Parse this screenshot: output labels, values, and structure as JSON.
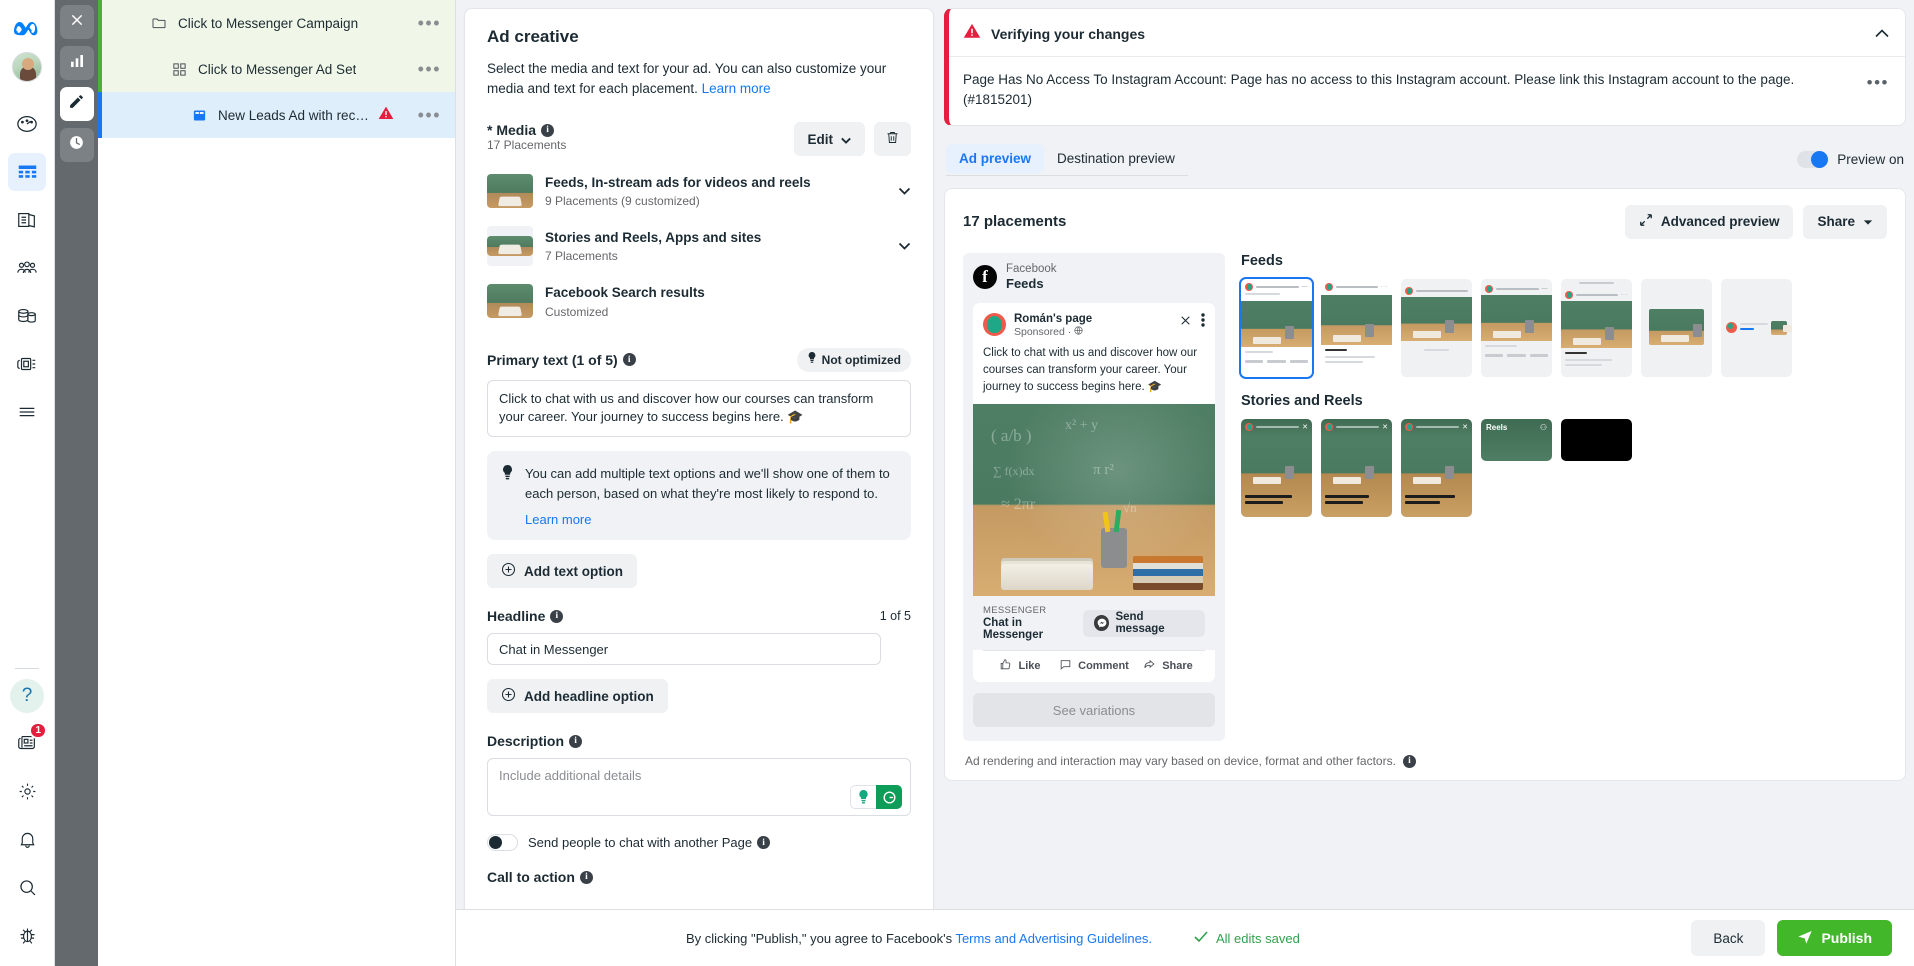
{
  "nav": {
    "logo": "meta-logo",
    "items": [
      {
        "name": "speedometer-icon",
        "label": "Performance"
      },
      {
        "name": "table-icon",
        "label": "Campaigns"
      },
      {
        "name": "pages-icon",
        "label": "Pages"
      },
      {
        "name": "audience-icon",
        "label": "Audiences"
      },
      {
        "name": "billing-icon",
        "label": "Billing"
      },
      {
        "name": "assets-icon",
        "label": "Assets"
      },
      {
        "name": "menu-icon",
        "label": "All tools"
      }
    ],
    "help_label": "?",
    "notifications_badge": "1",
    "bottom_items": [
      {
        "name": "news-icon",
        "label": "News"
      },
      {
        "name": "gear-icon",
        "label": "Settings"
      },
      {
        "name": "bell-icon",
        "label": "Notifications"
      },
      {
        "name": "search-icon",
        "label": "Search"
      },
      {
        "name": "bug-icon",
        "label": "Report a bug"
      }
    ]
  },
  "toolstrip": {
    "items": [
      {
        "name": "close-icon",
        "label": "Close"
      },
      {
        "name": "chart-icon",
        "label": "Charts"
      },
      {
        "name": "edit-icon",
        "label": "Edit"
      },
      {
        "name": "history-icon",
        "label": "History"
      }
    ]
  },
  "tree": {
    "rows": [
      {
        "label": "Click to Messenger Campaign",
        "icon": "folder-icon",
        "more": "•••"
      },
      {
        "label": "Click to Messenger Ad Set",
        "icon": "grid-icon",
        "more": "•••"
      },
      {
        "label": "New Leads Ad with recomme…",
        "icon": "ad-icon",
        "more": "•••",
        "warning": true
      }
    ]
  },
  "creative": {
    "title": "Ad creative",
    "description": "Select the media and text for your ad. You can also customize your media and text for each placement.",
    "learn_more": "Learn more",
    "media_label": "* Media",
    "media_sub": "17 Placements",
    "edit_button": "Edit",
    "delete_icon": "trash-icon",
    "media_items": [
      {
        "name": "Feeds, In-stream ads for videos and reels",
        "sub": "9 Placements (9 customized)"
      },
      {
        "name": "Stories and Reels, Apps and sites",
        "sub": "7 Placements"
      },
      {
        "name": "Facebook Search results",
        "sub": "Customized"
      }
    ],
    "primary_text_label": "Primary text (1 of 5)",
    "not_optimized_badge": "Not optimized",
    "primary_text_value": "Click to chat with us and discover how our courses can transform your career. Your journey to success begins here. 🎓",
    "tip_text": "You can add multiple text options and we'll show one of them to each person, based on what they're most likely to respond to.",
    "tip_learn_more": "Learn more",
    "add_text_option": "Add text option",
    "headline_label": "Headline",
    "headline_count": "1 of 5",
    "headline_value": "Chat in Messenger",
    "add_headline_option": "Add headline option",
    "description_label": "Description",
    "description_placeholder": "Include additional details",
    "toggle_label": "Send people to chat with another Page",
    "cta_label": "Call to action"
  },
  "alert": {
    "title": "Verifying your changes",
    "message": "Page Has No Access To Instagram Account: Page has no access to this Instagram account. Please link this Instagram account to the page. (#1815201)",
    "collapse_icon": "chevron-up-icon",
    "more": "•••",
    "accent_color": "#e41e3f"
  },
  "preview": {
    "tabs": [
      {
        "label": "Ad preview",
        "active": true
      },
      {
        "label": "Destination preview",
        "active": false
      }
    ],
    "toggle_label": "Preview on",
    "placements_count": "17 placements",
    "advanced_button": "Advanced preview",
    "share_button": "Share",
    "footnote": "Ad rendering and interaction may vary based on device, format and other factors.",
    "mock": {
      "platform_top": "Facebook",
      "platform_name": "Feeds",
      "page_name": "Román's page",
      "page_sub": "Sponsored ·",
      "post_text": "Click to chat with us and discover how our courses can transform your career. Your journey to success begins here. 🎓",
      "cta_kicker": "MESSENGER",
      "cta_headline": "Chat in Messenger",
      "cta_button": "Send message",
      "actions": [
        {
          "label": "Like",
          "icon": "thumbs-up-icon"
        },
        {
          "label": "Comment",
          "icon": "comment-icon"
        },
        {
          "label": "Share",
          "icon": "share-icon"
        }
      ],
      "see_variations": "See variations"
    },
    "groups": [
      {
        "title": "Feeds",
        "tiles": 7
      },
      {
        "title": "Stories and Reels",
        "tiles": 5
      }
    ]
  },
  "bottom": {
    "legal_prefix": "By clicking \"Publish,\" you agree to Facebook's ",
    "legal_link": "Terms and Advertising Guidelines.",
    "saved_status": "All edits saved",
    "back_button": "Back",
    "publish_button": "Publish"
  }
}
